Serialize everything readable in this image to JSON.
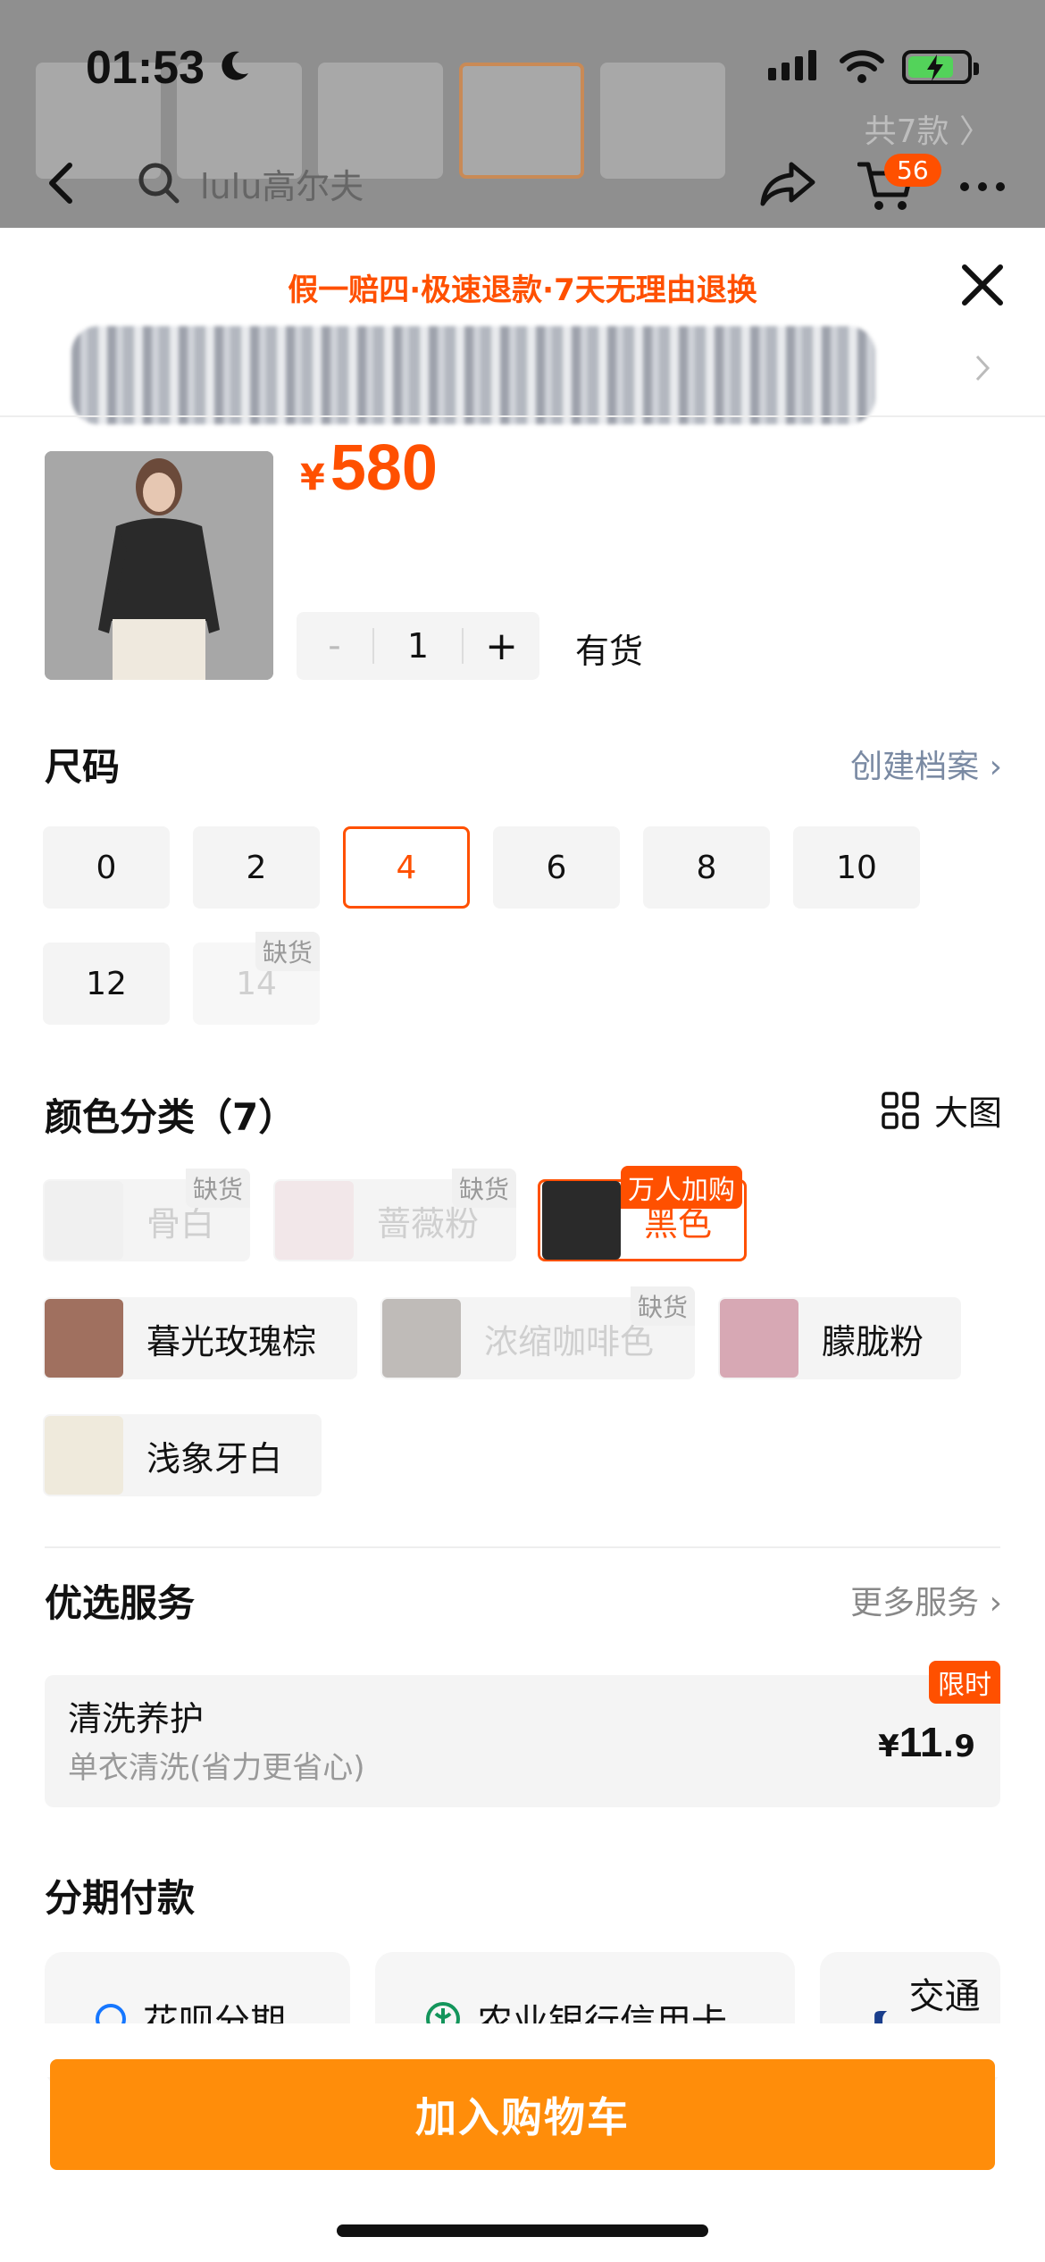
{
  "status_bar": {
    "time": "01:53"
  },
  "background": {
    "count_label": "共7款 〉"
  },
  "nav": {
    "search_text": "lulu高尔夫",
    "cart_badge": "56"
  },
  "sheet": {
    "promo": "假一赔四·极速退款·7天无理由退换",
    "price_currency": "¥",
    "price": "580",
    "quantity": "1",
    "minus": "-",
    "plus": "+",
    "stock": "有货"
  },
  "size_section": {
    "title": "尺码",
    "link": "创建档案 ›",
    "sizes": [
      "0",
      "2",
      "4",
      "6",
      "8",
      "10",
      "12",
      "14"
    ],
    "selected": "4",
    "out_of_stock_tag": "缺货"
  },
  "color_section": {
    "title": "颜色分类（7）",
    "big_view": "大图",
    "colors": [
      "骨白",
      "蔷薇粉",
      "黑色",
      "暮光玫瑰棕",
      "浓缩咖啡色",
      "朦胧粉",
      "浅象牙白"
    ],
    "out_of_stock_tag": "缺货",
    "hot_tag": "万人加购",
    "thumb_colors": [
      "#ececec",
      "#f0d9dd",
      "#2a2a2a",
      "#a0705f",
      "#8a817c",
      "#d7a8b4",
      "#efeadc"
    ]
  },
  "service_section": {
    "title": "优选服务",
    "link": "更多服务 ›",
    "card": {
      "name": "清洗养护",
      "desc": "单衣清洗(省力更省心)",
      "price_cur": "¥",
      "price_int": "11",
      "price_dec": ".9",
      "tag": "限时"
    }
  },
  "installment_section": {
    "title": "分期付款",
    "options": [
      "花呗分期",
      "农业银行信用卡",
      "交通银行"
    ]
  },
  "add_to_cart": "加入购物车",
  "colors": {
    "accent": "#ff5000",
    "button": "#ff8d0a"
  }
}
